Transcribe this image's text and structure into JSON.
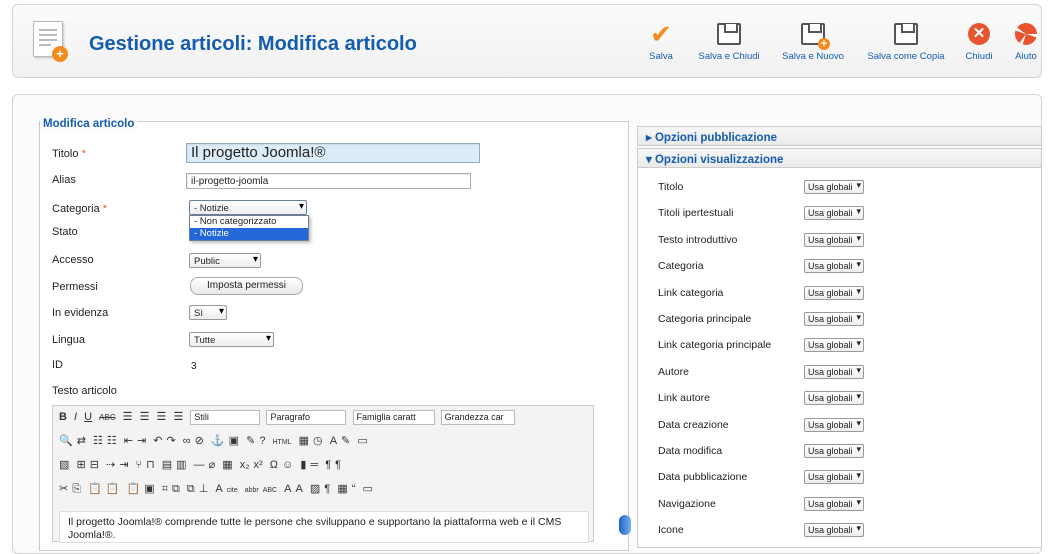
{
  "header": {
    "title": "Gestione articoli: Modifica articolo"
  },
  "toolbar": {
    "save": "Salva",
    "save_close": "Salva e Chiudi",
    "save_new": "Salva e Nuovo",
    "save_copy": "Salva come Copia",
    "close": "Chiudi",
    "help": "Aiuto"
  },
  "colors": {
    "accent": "#135cae",
    "orange": "#f28c1e",
    "close": "#e8542e",
    "selected": "#2467d8"
  },
  "form": {
    "legend": "Modifica articolo",
    "title_label": "Titolo",
    "title_value": "Il progetto Joomla!®",
    "alias_label": "Alias",
    "alias_value": "il-progetto-joomla",
    "category_label": "Categoria",
    "category_value": "- Notizie",
    "category_options": [
      "- Non categorizzato",
      "- Notizie"
    ],
    "state_label": "Stato",
    "access_label": "Accesso",
    "access_value": "Public",
    "permissions_label": "Permessi",
    "permissions_button": "Imposta permessi",
    "featured_label": "In evidenza",
    "featured_value": "Sì",
    "language_label": "Lingua",
    "language_value": "Tutte",
    "id_label": "ID",
    "id_value": "3",
    "text_label": "Testo articolo",
    "required_mark": "*"
  },
  "editor": {
    "styles": "Stili",
    "format": "Paragrafo",
    "font_family": "Famiglia caratt",
    "font_size": "Grandezza car",
    "content": "Il progetto Joomla!® comprende tutte le persone che sviluppano e supportano la piattaforma web e il CMS Joomla!®."
  },
  "panels": {
    "publishing": "Opzioni pubblicazione",
    "display": "Opzioni visualizzazione",
    "options": [
      {
        "label": "Titolo",
        "value": "Usa globali"
      },
      {
        "label": "Titoli ipertestuali",
        "value": "Usa globali"
      },
      {
        "label": "Testo introduttivo",
        "value": "Usa globali"
      },
      {
        "label": "Categoria",
        "value": "Usa globali"
      },
      {
        "label": "Link categoria",
        "value": "Usa globali"
      },
      {
        "label": "Categoria principale",
        "value": "Usa globali"
      },
      {
        "label": "Link categoria principale",
        "value": "Usa globali"
      },
      {
        "label": "Autore",
        "value": "Usa globali"
      },
      {
        "label": "Link autore",
        "value": "Usa globali"
      },
      {
        "label": "Data creazione",
        "value": "Usa globali"
      },
      {
        "label": "Data modifica",
        "value": "Usa globali"
      },
      {
        "label": "Data pubblicazione",
        "value": "Usa globali"
      },
      {
        "label": "Navigazione",
        "value": "Usa globali"
      },
      {
        "label": "Icone",
        "value": "Usa globali"
      }
    ]
  }
}
